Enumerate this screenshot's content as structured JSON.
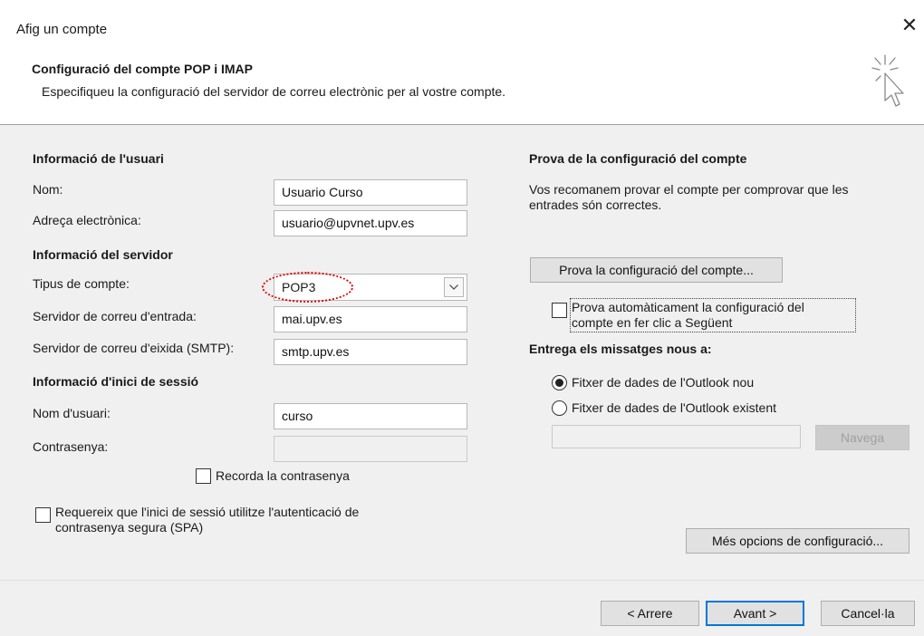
{
  "window": {
    "title": "Afig un compte",
    "close_glyph": "✕",
    "icon": "cursor-sparkle-icon"
  },
  "header": {
    "title": "Configuració del compte POP i IMAP",
    "subtitle": "Especifiqueu la configuració del servidor de correu electrònic per al vostre compte."
  },
  "user_info": {
    "section": "Informació de l'usuari",
    "name_label": "Nom:",
    "name_value": "Usuario Curso",
    "email_label": "Adreça electrònica:",
    "email_value": "usuario@upvnet.upv.es"
  },
  "server_info": {
    "section": "Informació del servidor",
    "account_type_label": "Tipus de compte:",
    "account_type_value": "POP3",
    "incoming_label": "Servidor de correu d'entrada:",
    "incoming_value": "mai.upv.es",
    "outgoing_label": "Servidor de correu d'eixida (SMTP):",
    "outgoing_value": "smtp.upv.es"
  },
  "login_info": {
    "section": "Informació d'inici de sessió",
    "username_label": "Nom d'usuari:",
    "username_value": "curso",
    "password_label": "Contrasenya:",
    "password_value": "",
    "remember_label": "Recorda la contrasenya",
    "remember_checked": false,
    "spa_line1": "Requereix que l'inici de sessió utilitze l'autenticació de",
    "spa_line2": "contrasenya segura (SPA)",
    "spa_checked": false
  },
  "test": {
    "section": "Prova de la configuració del compte",
    "desc_line1": "Vos recomanem provar el compte per comprovar que les",
    "desc_line2": "entrades són correctes.",
    "button": "Prova la configuració del compte...",
    "auto_line1": "Prova automàticament la configuració del",
    "auto_line2": "compte en fer clic a Següent",
    "auto_checked": false
  },
  "deliver": {
    "section": "Entrega els missatges nous a:",
    "option_new": "Fitxer de dades de l'Outlook nou",
    "option_existing": "Fitxer de dades de l'Outlook existent",
    "selected": "new",
    "path_value": "",
    "browse_button": "Navega"
  },
  "more_settings_button": "Més opcions de configuració...",
  "footer": {
    "back": "< Arrere",
    "next": "Avant >",
    "cancel": "Cancel·la"
  },
  "colors": {
    "default_button_border": "#0078d7",
    "annotation": "#e00000"
  }
}
